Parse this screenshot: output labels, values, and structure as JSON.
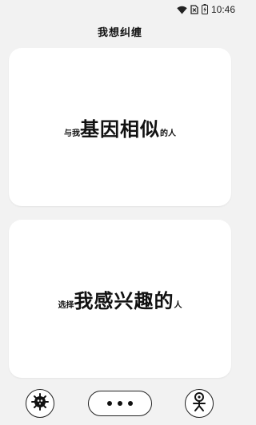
{
  "status_bar": {
    "time": "10:46",
    "icons": [
      "wifi-icon",
      "no-sim-icon",
      "battery-icon"
    ]
  },
  "header": {
    "title": "我想纠缠"
  },
  "cards": [
    {
      "prefix": "与我",
      "emphasis": "基因相似",
      "suffix": "的人"
    },
    {
      "prefix": "选择",
      "emphasis": "我感兴趣的",
      "suffix": "人"
    }
  ],
  "bottom_nav": {
    "left_icon": "virus-icon",
    "center_icon": "more-dots-icon",
    "right_icon": "profile-figure-icon"
  }
}
